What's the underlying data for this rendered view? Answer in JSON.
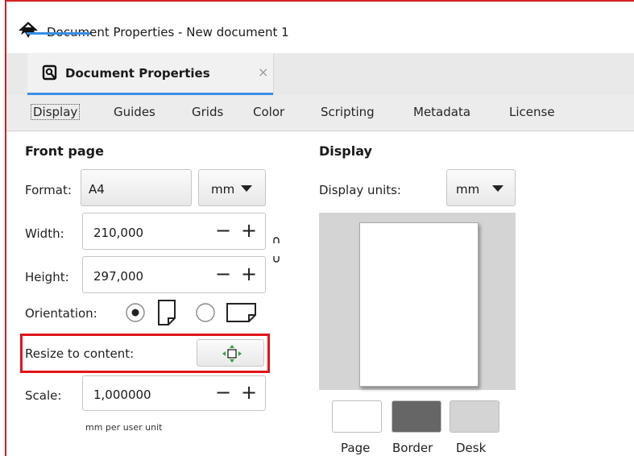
{
  "window": {
    "title": "Document Properties - New document 1"
  },
  "tab": {
    "label": "Document Properties",
    "close_glyph": "×"
  },
  "subtabs": [
    "Display",
    "Guides",
    "Grids",
    "Color",
    "Scripting",
    "Metadata",
    "License"
  ],
  "front_page": {
    "heading": "Front page",
    "format_label": "Format:",
    "format_value": "A4",
    "format_unit": "mm",
    "width_label": "Width:",
    "width_value": "210,000",
    "height_label": "Height:",
    "height_value": "297,000",
    "orientation_label": "Orientation:",
    "orientation_selected": "portrait",
    "resize_label": "Resize to content:",
    "scale_label": "Scale:",
    "scale_value": "1,000000",
    "scale_unit_note": "mm per user unit"
  },
  "display": {
    "heading": "Display",
    "units_label": "Display units:",
    "units_value": "mm",
    "swatches": [
      {
        "label": "Page",
        "color": "#ffffff"
      },
      {
        "label": "Border",
        "color": "#666666"
      },
      {
        "label": "Desk",
        "color": "#d4d4d4"
      }
    ]
  },
  "glyphs": {
    "minus": "−",
    "plus": "+"
  },
  "colors": {
    "accent": "#3a8ee6",
    "highlight": "#e0141a",
    "window_border": "#d61f1f"
  }
}
